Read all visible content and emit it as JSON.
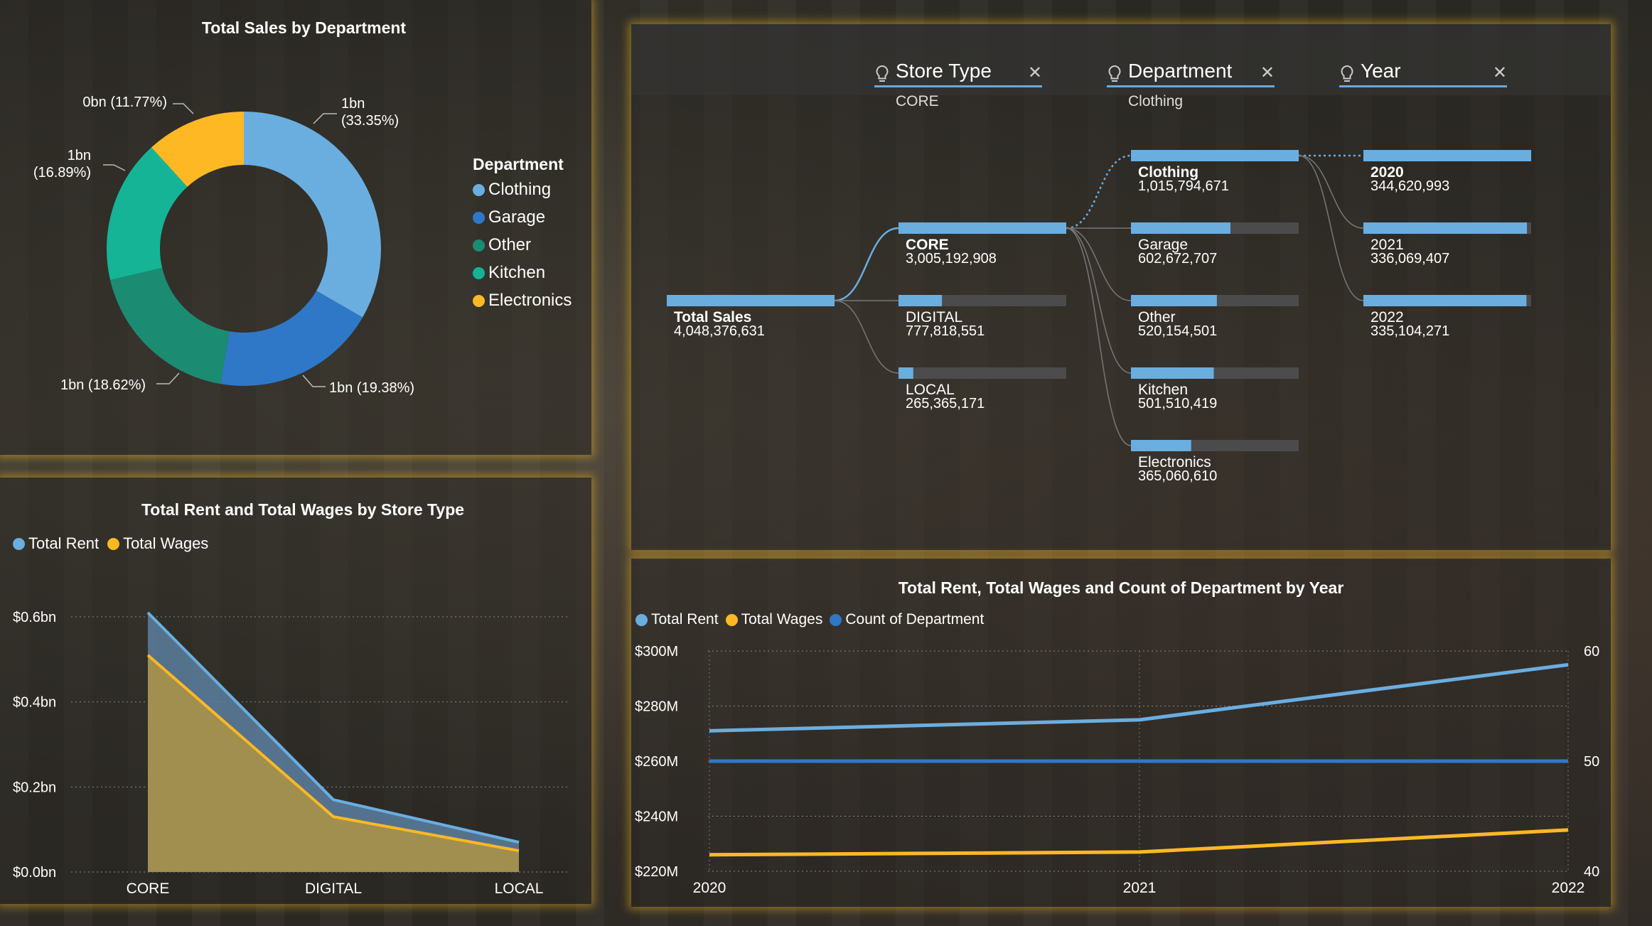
{
  "colors": {
    "clothing": "#6aaee0",
    "garage": "#2f78c8",
    "other": "#1b8c72",
    "kitchen": "#15b496",
    "electronics": "#fdb824",
    "rent": "#6aaee0",
    "wages": "#fdb824",
    "count": "#2f78c8"
  },
  "donut": {
    "title": "Total Sales by Department",
    "legend_title": "Department",
    "legend": [
      "Clothing",
      "Garage",
      "Other",
      "Kitchen",
      "Electronics"
    ]
  },
  "filters": [
    {
      "name": "Store Type",
      "value": "CORE",
      "icon": "lightbulb-icon"
    },
    {
      "name": "Department",
      "value": "Clothing",
      "icon": "lightbulb-icon"
    },
    {
      "name": "Year",
      "value": "",
      "icon": "lightbulb-icon"
    }
  ],
  "tree": {
    "root": {
      "label": "Total Sales",
      "value": "4,048,376,631"
    },
    "store_types": [
      {
        "label": "CORE",
        "value": "3,005,192,908",
        "fraction": 1.0,
        "selected": true
      },
      {
        "label": "DIGITAL",
        "value": "777,818,551",
        "fraction": 0.259
      },
      {
        "label": "LOCAL",
        "value": "265,365,171",
        "fraction": 0.088
      }
    ],
    "departments": [
      {
        "label": "Clothing",
        "value": "1,015,794,671",
        "fraction": 1.0,
        "selected": true
      },
      {
        "label": "Garage",
        "value": "602,672,707",
        "fraction": 0.593
      },
      {
        "label": "Other",
        "value": "520,154,501",
        "fraction": 0.512
      },
      {
        "label": "Kitchen",
        "value": "501,510,419",
        "fraction": 0.494
      },
      {
        "label": "Electronics",
        "value": "365,060,610",
        "fraction": 0.359
      }
    ],
    "years": [
      {
        "label": "2020",
        "value": "344,620,993",
        "fraction": 1.0,
        "selected": true
      },
      {
        "label": "2021",
        "value": "336,069,407",
        "fraction": 0.975
      },
      {
        "label": "2022",
        "value": "335,104,271",
        "fraction": 0.972
      }
    ]
  },
  "area": {
    "title": "Total Rent and Total Wages by Store Type",
    "legend": [
      "Total Rent",
      "Total Wages"
    ]
  },
  "line": {
    "title": "Total Rent, Total Wages and Count of Department by Year",
    "legend": [
      "Total Rent",
      "Total Wages",
      "Count of Department"
    ]
  },
  "chart_data": [
    {
      "type": "pie",
      "title": "Total Sales by Department",
      "legend_title": "Department",
      "categories": [
        "Clothing",
        "Garage",
        "Other",
        "Kitchen",
        "Electronics"
      ],
      "percent": [
        33.35,
        19.38,
        18.62,
        16.89,
        11.77
      ],
      "labels": [
        "1bn\n(33.35%)",
        "1bn (19.38%)",
        "1bn (18.62%)",
        "1bn\n(16.89%)",
        "0bn (11.77%)"
      ]
    },
    {
      "type": "area",
      "title": "Total Rent and Total Wages by Store Type",
      "categories": [
        "CORE",
        "DIGITAL",
        "LOCAL"
      ],
      "series": [
        {
          "name": "Total Rent",
          "values": [
            0.61,
            0.17,
            0.07
          ]
        },
        {
          "name": "Total Wages",
          "values": [
            0.51,
            0.13,
            0.05
          ]
        }
      ],
      "ylim": [
        0,
        0.6
      ],
      "yticks": [
        "$0.0bn",
        "$0.2bn",
        "$0.4bn",
        "$0.6bn"
      ],
      "grid": true,
      "legend": "top-left"
    },
    {
      "type": "line",
      "title": "Total Rent, Total Wages and Count of Department by Year",
      "x": [
        "2020",
        "2021",
        "2022"
      ],
      "series": [
        {
          "name": "Total Rent",
          "axis": "left",
          "values": [
            271,
            275,
            295
          ]
        },
        {
          "name": "Total Wages",
          "axis": "left",
          "values": [
            226,
            227,
            235
          ]
        },
        {
          "name": "Count of Department",
          "axis": "right",
          "values": [
            50,
            50,
            50
          ]
        }
      ],
      "ylim_left": [
        220,
        300
      ],
      "yticks_left": [
        "$220M",
        "$240M",
        "$260M",
        "$280M",
        "$300M"
      ],
      "ylim_right": [
        40,
        60
      ],
      "yticks_right": [
        "40",
        "50",
        "60"
      ],
      "grid": true,
      "legend": "top-left"
    }
  ]
}
